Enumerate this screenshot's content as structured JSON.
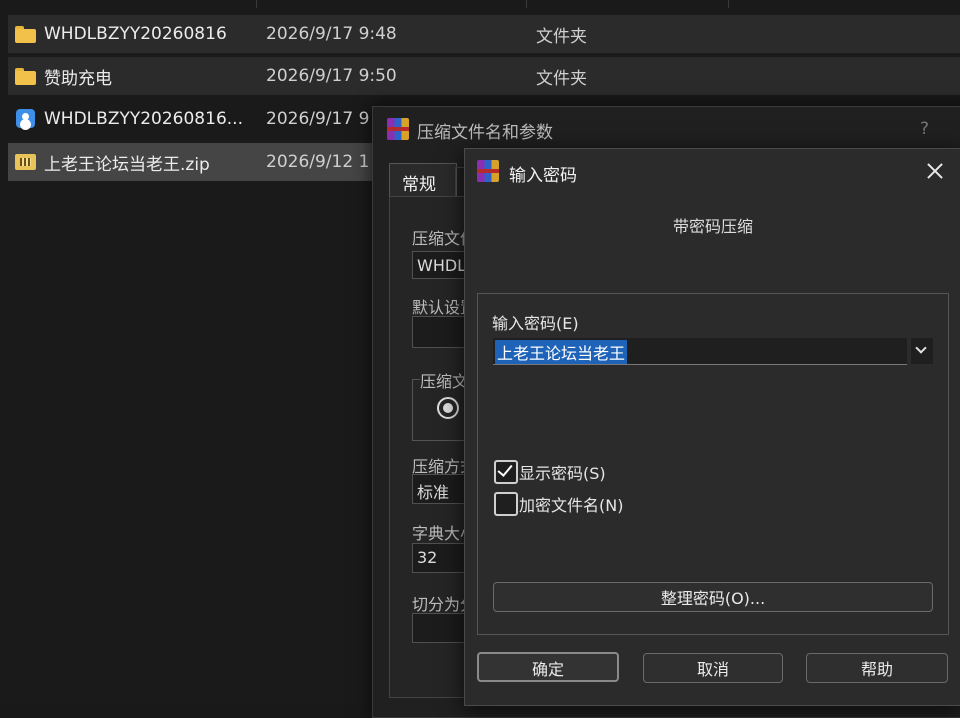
{
  "explorer": {
    "files": [
      {
        "name": "WHDLBZYY20260816",
        "date": "2026/9/17 9:48",
        "type": "文件夹",
        "icon": "folder-icon"
      },
      {
        "name": "赞助充电",
        "date": "2026/9/17 9:50",
        "type": "文件夹",
        "icon": "folder-icon"
      },
      {
        "name": "WHDLBZYY20260816...",
        "date": "2026/9/17 9",
        "type": "",
        "icon": "app-icon"
      },
      {
        "name": "上老王论坛当老王.zip",
        "date": "2026/9/12 1",
        "type": "",
        "icon": "zip-icon"
      }
    ]
  },
  "archive_dialog": {
    "title": "压缩文件名和参数",
    "help": "?",
    "tab_general": "常规",
    "archive_name_label": "压缩文件",
    "archive_name_value": "WHDLB",
    "default_profile_label": "默认设置",
    "format_group_label": "压缩文",
    "method_label": "压缩方式",
    "method_value": "标准",
    "dict_label": "字典大小",
    "dict_value": "32",
    "split_label": "切分为分"
  },
  "password_dialog": {
    "title": "输入密码",
    "subtitle": "带密码压缩",
    "password_label": "输入密码(E)",
    "password_value": "上老王论坛当老王",
    "show_password_label": "显示密码(S)",
    "show_password_checked": true,
    "encrypt_names_label": "加密文件名(N)",
    "encrypt_names_checked": false,
    "organize_button": "整理密码(O)...",
    "ok_button": "确定",
    "cancel_button": "取消",
    "help_button": "帮助"
  }
}
